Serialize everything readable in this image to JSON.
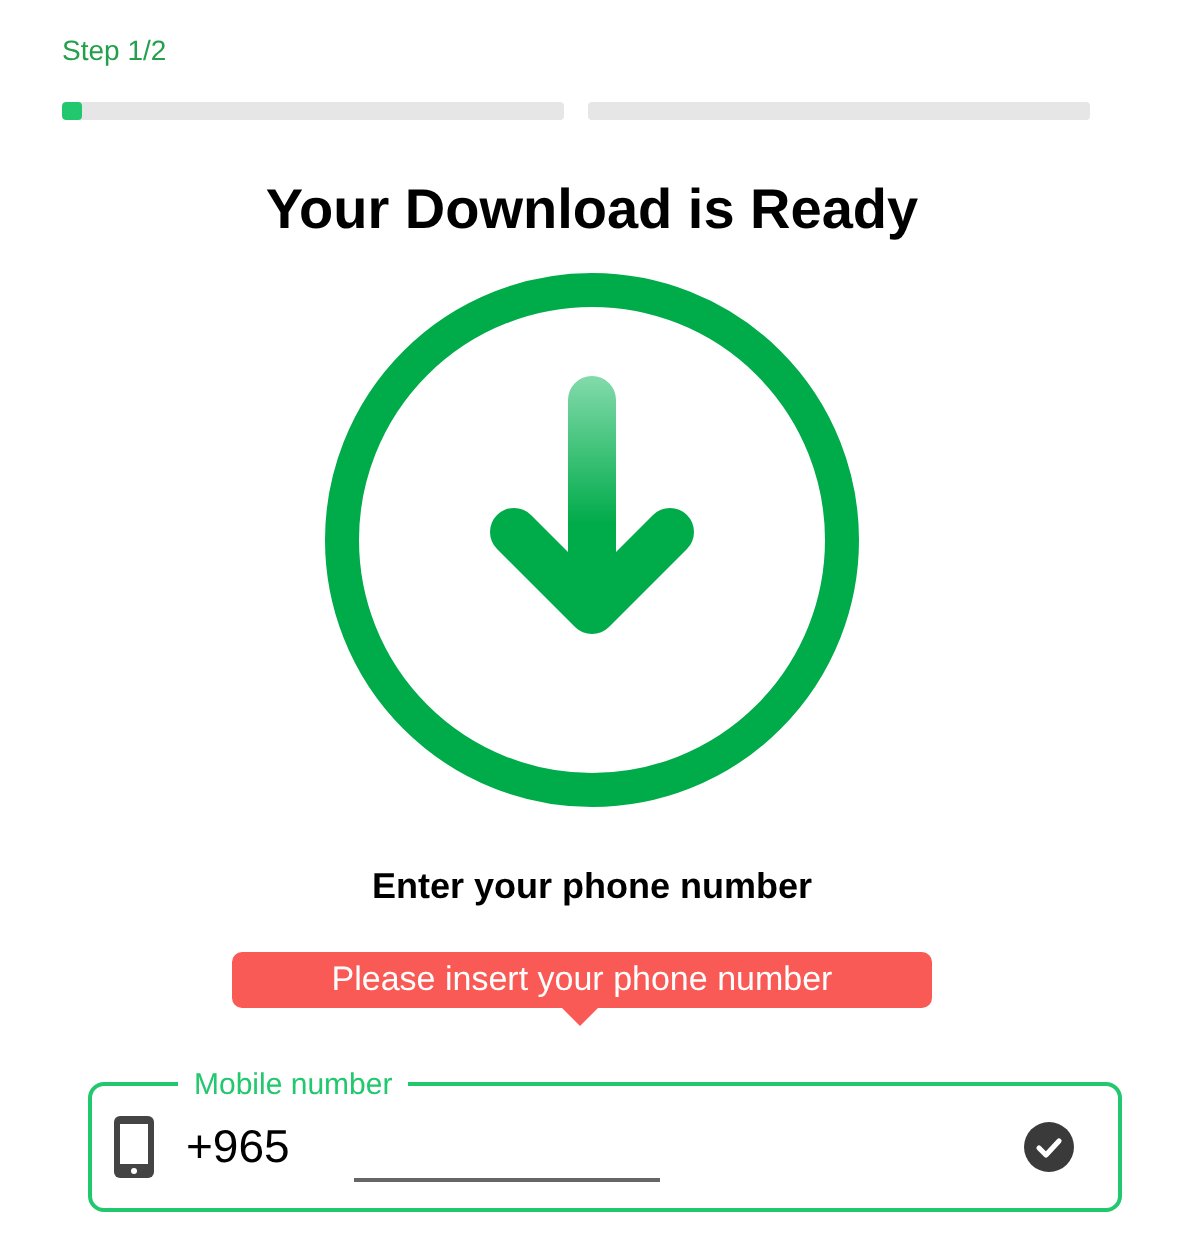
{
  "step_label": "Step 1/2",
  "progress": [
    {
      "kind": "current",
      "level": 0.04
    },
    {
      "kind": "pending"
    }
  ],
  "title": "Your Download is Ready",
  "prompt": "Enter your phone number",
  "tooltip": "Please insert your phone number",
  "phone_field": {
    "label": "Mobile number",
    "prefix": "+965",
    "valid": true
  }
}
